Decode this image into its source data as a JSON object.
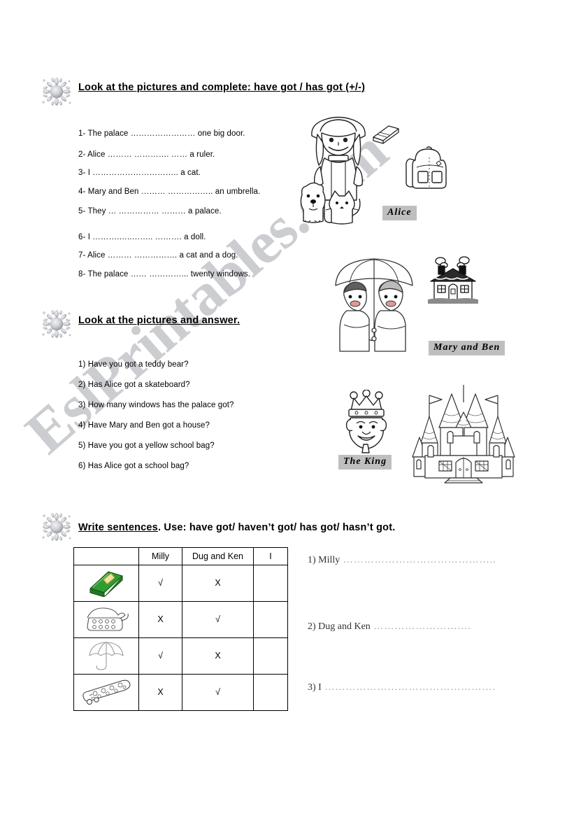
{
  "watermark": {
    "text": "EslPrintables.com",
    "color": "#c9cbcf"
  },
  "sections": [
    {
      "id": "exercise-1",
      "heading_underlined": "Look at the pictures and complete:  have got   /    has got    (+/-)",
      "heading_plain": "",
      "items": [
        "1- The palace …………………… one big door.",
        "2- Alice ……… …………. ……  a ruler.",
        "3- I ………………………….. a cat.",
        "4- Mary and Ben ……… …………….. an umbrella.",
        "5- They … …………… ……… a palace.",
        "6- I ……….…..…….. ………. a doll.",
        "7- Alice ……… ……………. a cat and a dog.",
        "8- The palace …… …………... twenty windows."
      ]
    },
    {
      "id": "exercise-2",
      "heading_underlined": "Look at the pictures and answer.",
      "heading_plain": "",
      "items": [
        "1) Have you got a teddy bear?",
        "2) Has Alice got a skateboard?",
        "3) How many windows has the palace got?",
        "4) Have Mary and Ben got a house?",
        "5) Have you got a yellow school bag?",
        "6) Has Alice got a school bag?"
      ]
    },
    {
      "id": "exercise-3",
      "heading_underlined": "Write sentences",
      "heading_plain": ". Use:  have got/ haven’t got/ has got/ hasn’t got.",
      "items": []
    }
  ],
  "picture_labels": [
    {
      "name": "alice",
      "text": "Alice"
    },
    {
      "name": "mary-and-ben",
      "text": "Mary and Ben"
    },
    {
      "name": "the-king",
      "text": "The King"
    }
  ],
  "pictures": [
    {
      "name": "girl-with-dog-and-cat-illustration"
    },
    {
      "name": "eraser-illustration"
    },
    {
      "name": "school-bag-illustration"
    },
    {
      "name": "two-kids-under-umbrella-illustration"
    },
    {
      "name": "house-illustration"
    },
    {
      "name": "king-head-illustration"
    },
    {
      "name": "castle-illustration"
    }
  ],
  "table": {
    "headers": [
      "",
      "Milly",
      "Dug and Ken",
      "I"
    ],
    "rows": [
      {
        "item": "book",
        "milly": "√",
        "dug_and_ken": "X",
        "i": ""
      },
      {
        "item": "telephone",
        "milly": "X",
        "dug_and_ken": "√",
        "i": ""
      },
      {
        "item": "umbrella",
        "milly": "√",
        "dug_and_ken": "X",
        "i": ""
      },
      {
        "item": "skateboard",
        "milly": "X",
        "dug_and_ken": "√",
        "i": ""
      }
    ]
  },
  "write_prompts": [
    {
      "label": "1) Milly",
      "dots": " …………………………………….."
    },
    {
      "label": "2) Dug and Ken",
      "dots": " ………………………."
    },
    {
      "label": "3) I",
      "dots": " …………………………………………."
    }
  ]
}
